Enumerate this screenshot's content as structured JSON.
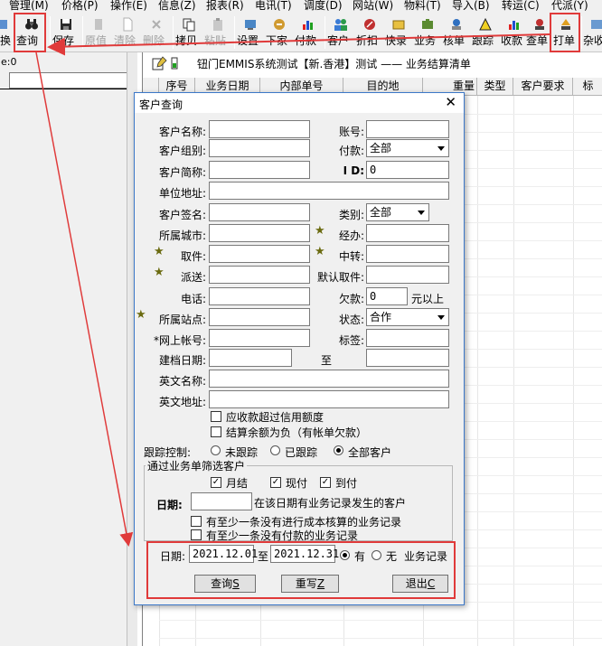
{
  "menu": [
    "管理(M)",
    "价格(P)",
    "操作(E)",
    "信息(Z)",
    "报表(R)",
    "电讯(T)",
    "调度(D)",
    "网站(W)",
    "物料(T)",
    "导入(B)",
    "转运(C)",
    "代派(Y)"
  ],
  "toolbar": {
    "left_cut_label": "切换",
    "query": "查询",
    "save": "保存",
    "original": "原值",
    "clear": "清除",
    "delete": "删除",
    "copy": "拷贝",
    "paste": "粘贴",
    "settings": "设置",
    "dispatch": "下家",
    "payment": "付款",
    "customer": "客户",
    "discount": "折扣",
    "express": "快录",
    "business": "业务",
    "audit": "核单",
    "track": "跟踪",
    "collect": "收款",
    "check_order": "查单",
    "print_order": "打单",
    "misc": "杂收"
  },
  "left_panel": {
    "label": "e:0",
    "input_value": ""
  },
  "main": {
    "title": "钮门EMMIS系统测试【新.香港】测试 —— 业务结算清单",
    "columns": [
      "序号",
      "业务日期",
      "内部单号",
      "目的地",
      "重量",
      "类型",
      "客户要求",
      "标"
    ]
  },
  "dialog": {
    "title": "客户查询",
    "close_symbol": "✕",
    "fields": {
      "customer_name": {
        "label": "客户名称:",
        "value": ""
      },
      "account_no": {
        "label": "账号:",
        "value": ""
      },
      "customer_group": {
        "label": "客户组别:",
        "value": ""
      },
      "payment": {
        "label": "付款:",
        "value": "全部"
      },
      "customer_short": {
        "label": "客户简称:",
        "value": ""
      },
      "id": {
        "label": "I D:",
        "value": "0"
      },
      "unit_address": {
        "label": "单位地址:",
        "value": ""
      },
      "customer_sign": {
        "label": "客户签名:",
        "value": ""
      },
      "category": {
        "label": "类别:",
        "value": "全部"
      },
      "city": {
        "label": "所属城市:",
        "value": ""
      },
      "handler": {
        "label": "经办:",
        "value": ""
      },
      "pickup": {
        "label": "取件:",
        "value": ""
      },
      "transfer": {
        "label": "中转:",
        "value": ""
      },
      "delivery": {
        "label": "派送:",
        "value": ""
      },
      "default_pickup": {
        "label": "默认取件:",
        "value": ""
      },
      "phone": {
        "label": "电话:",
        "value": ""
      },
      "arrears": {
        "label": "欠款:",
        "value": "0",
        "suffix": "元以上"
      },
      "site": {
        "label": "所属站点:",
        "value": ""
      },
      "status": {
        "label": "状态:",
        "value": "合作"
      },
      "online_account": {
        "label": "*网上帐号:",
        "value": ""
      },
      "tag": {
        "label": "标签:",
        "value": ""
      },
      "created_date": {
        "label": "建档日期:",
        "value": "",
        "to_label": "至",
        "to_value": ""
      },
      "english_name": {
        "label": "英文名称:",
        "value": ""
      },
      "english_address": {
        "label": "英文地址:",
        "value": ""
      }
    },
    "checks": {
      "over_credit": "应收款超过信用额度",
      "negative_balance": "结算余额为负（有帐单欠款）"
    },
    "tracking": {
      "label": "跟踪控制:",
      "options": [
        "未跟踪",
        "已跟踪",
        "全部客户"
      ],
      "selected": "全部客户"
    },
    "filter_group": {
      "title": "通过业务单筛选客户",
      "monthly": "月结",
      "cash": "现付",
      "cod": "到付",
      "date_label": "日期:",
      "date_value": "",
      "date_hint": "在该日期有业务记录发生的客户",
      "uncosted": "有至少一条没有进行成本核算的业务记录",
      "unpaid": "有至少一条没有付款的业务记录"
    },
    "date_range": {
      "label": "日期:",
      "from": "2021.12.01",
      "to_label": "至",
      "to": "2021.12.31",
      "has": "有",
      "none": "无",
      "suffix": "业务记录"
    },
    "buttons": {
      "query": "查询",
      "query_key": "S",
      "rewrite": "重写",
      "rewrite_key": "Z",
      "exit": "退出",
      "exit_key": "C"
    }
  },
  "colors": {
    "highlight": "#e03a3a",
    "dialog_border": "#3c78c8"
  }
}
